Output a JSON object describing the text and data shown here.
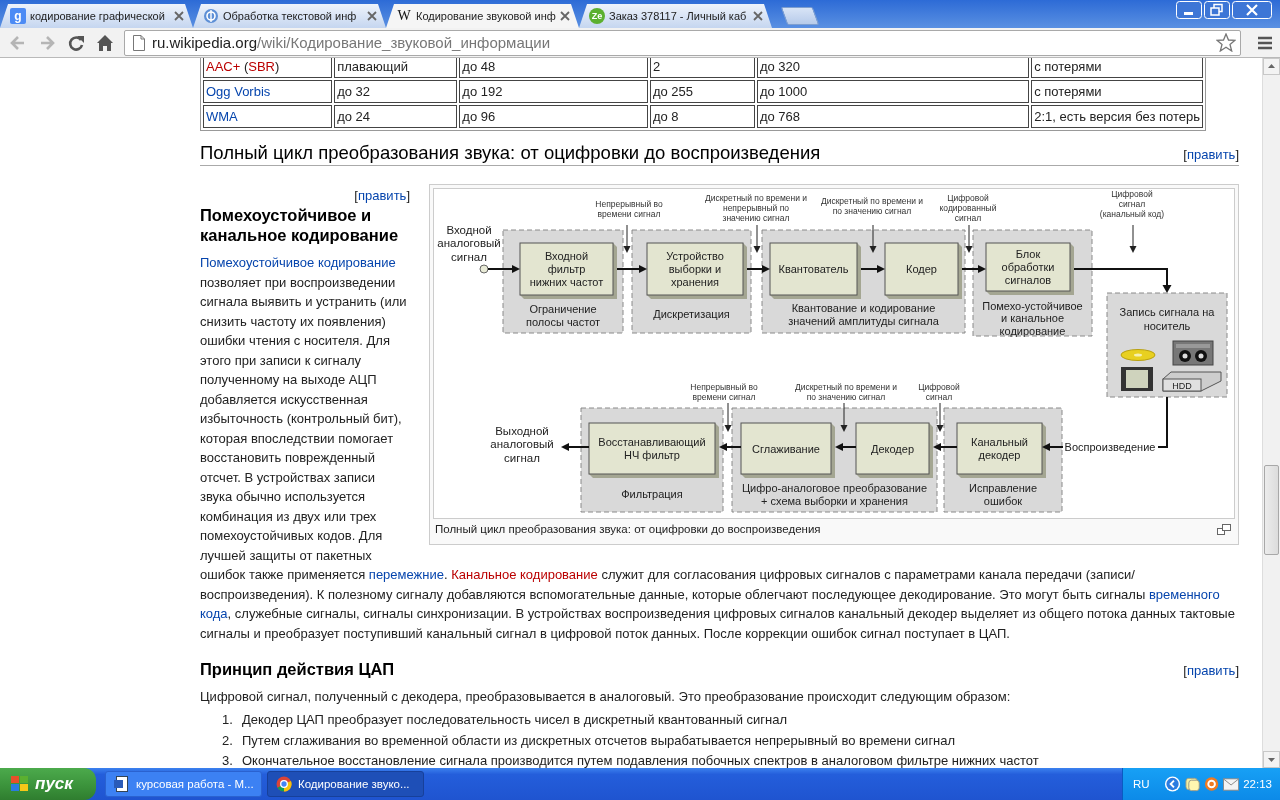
{
  "browser": {
    "tabs": [
      {
        "title": "кодирование графической",
        "selected": false,
        "kind": "square",
        "glyph": "g"
      },
      {
        "title": "Обработка текстовой инф",
        "selected": false,
        "kind": "ring"
      },
      {
        "title": "Кодирование звуковой инф",
        "selected": true,
        "kind": "letter",
        "glyph": "W"
      },
      {
        "title": "Заказ 378117 - Личный каб",
        "selected": false,
        "kind": "badge",
        "glyph": "Ze"
      }
    ],
    "url": {
      "host": "ru.wikipedia.org",
      "path": "/wiki/Кодирование_звуковой_информации"
    }
  },
  "article": {
    "table_rows": [
      {
        "cells": [
          [
            {
              "text": "AAC+",
              "kind": "missing"
            },
            {
              "text": " (",
              "kind": "plain"
            },
            {
              "text": "SBR",
              "kind": "missing"
            },
            {
              "text": ")",
              "kind": "plain"
            }
          ],
          "плавающий",
          "до 48",
          "2",
          "до 320",
          "с потерями"
        ]
      },
      {
        "cells": [
          [
            {
              "text": "Ogg Vorbis",
              "kind": "existing"
            }
          ],
          "до 32",
          "до 192",
          "до 255",
          "до 1000",
          "с потерями"
        ]
      },
      {
        "cells": [
          [
            {
              "text": "WMA",
              "kind": "existing"
            }
          ],
          "до 24",
          "до 96",
          "до 8",
          "до 768",
          "2:1, есть версия без потерь"
        ]
      }
    ],
    "section_heading": "Полный цикл преобразования звука: от оцифровки до воспроизведения",
    "section_edit": [
      {
        "text": "[",
        "kind": "plain"
      },
      {
        "text": "править",
        "kind": "existing"
      },
      {
        "text": "]",
        "kind": "plain"
      }
    ],
    "subsection_edit": [
      {
        "text": "[",
        "kind": "plain"
      },
      {
        "text": "править",
        "kind": "existing"
      },
      {
        "text": "]",
        "kind": "plain"
      }
    ],
    "subsection_heading": "Помехоустойчивое и канальное кодирование",
    "paragraph_beside_figure": [
      {
        "text": "Помехоустойчивое кодирование",
        "kind": "existing"
      },
      {
        "text": " позволяет при воспроизведении сигнала выявить и устранить (или снизить частоту их появления) ошибки чтения с носителя. Для этого при записи к сигналу полученному на выходе АЦП добавляется искусственная избыточность (контрольный бит), которая впоследствии помогает восстановить поврежденный отсчет. В устройствах записи звука обычно используется комбинация из двух или трех помехоустойчивых кодов. Для лучшей защиты от пакетных",
        "kind": "plain"
      }
    ],
    "paragraph_below_figure": [
      {
        "text": "ошибок также применяется ",
        "kind": "plain"
      },
      {
        "text": "перемежние",
        "kind": "existing"
      },
      {
        "text": ". ",
        "kind": "plain"
      },
      {
        "text": "Канальное кодирование",
        "kind": "missing"
      },
      {
        "text": " служит для согласования цифровых сигналов с параметрами канала передачи (записи/воспроизведения). К полезному сигналу добавляются вспомогательные данные, которые облегчают последующее декодирование. Это могут быть сигналы ",
        "kind": "plain"
      },
      {
        "text": "временного",
        "kind": "existing"
      },
      {
        "text": "кода",
        "kind": "existing"
      },
      {
        "text": ", служебные сигналы, сигналы синхронизации. В устройствах воспроизведения цифровых сигналов канальный декодер выделяет из общего потока данных тактовые сигналы и преобразует поступивший канальный сигнал в цифровой поток данных. После коррекции ошибок сигнал поступает в ЦАП.",
        "kind": "plain"
      }
    ],
    "figure": {
      "caption": "Полный цикл преобразования звука: от оцифровки до воспроизведения",
      "diagram": {
        "input_label": [
          "Входной",
          "аналоговый",
          "сигнал"
        ],
        "stages": [
          {
            "caption": [
              "Ограничение",
              "полосы частот"
            ],
            "blocks": [
              [
                "Входной",
                "фильтр",
                "нижних частот"
              ]
            ]
          },
          {
            "caption": [
              "Дискретизация"
            ],
            "blocks": [
              [
                "Устройство",
                "выборки и",
                "хранения"
              ]
            ]
          },
          {
            "caption": [
              "Квантование и кодирование",
              "значений амплитуды сигнала"
            ],
            "blocks": [
              [
                "Квантователь"
              ],
              [
                "Кодер"
              ]
            ]
          },
          {
            "caption": [
              "Помехо-устойчивое",
              "и канальное",
              "кодирование"
            ],
            "blocks": [
              [
                "Блок",
                "обработки",
                "сигналов"
              ]
            ]
          },
          {
            "caption": [
              "Фильтрация"
            ],
            "blocks": [
              [
                "Восстанавливающий",
                "НЧ фильтр"
              ]
            ]
          },
          {
            "caption": [
              "Цифро-аналоговое преобразование",
              "+ схема выборки и хранения"
            ],
            "blocks": [
              [
                "Сглаживание"
              ],
              [
                "Декодер"
              ]
            ]
          },
          {
            "caption": [
              "Исправление",
              "ошибок"
            ],
            "blocks": [
              [
                "Канальный",
                "декодер"
              ]
            ]
          }
        ],
        "signals": [
          {
            "lines": [
              "Непрерывный во",
              "времени сигнал"
            ]
          },
          {
            "lines": [
              "Дискретный по времени и",
              "непрерывный по",
              "значению сигнал"
            ]
          },
          {
            "lines": [
              "Дискретный по времени и",
              "по значению сигнал"
            ]
          },
          {
            "lines": [
              "Цифровой",
              "кодированный",
              "сигнал"
            ]
          },
          {
            "lines": [
              "Цифровой",
              "сигнал",
              "(канальный код)"
            ]
          },
          {
            "lines": [
              "Непрерывный во",
              "времени сигнал"
            ]
          },
          {
            "lines": [
              "Дискретный по времени и",
              "по значению сигнал"
            ]
          },
          {
            "lines": [
              "Цифровой",
              "сигнал"
            ]
          }
        ],
        "storage": {
          "title": [
            "Запись сигнала на",
            "носитель"
          ],
          "hdd_label": "HDD"
        },
        "playback_label": "Воспроизведение",
        "output_label": [
          "Выходной",
          "аналоговый",
          "сигнал"
        ]
      }
    },
    "dac_heading": "Принцип действия ЦАП",
    "dac_edit": [
      {
        "text": "[",
        "kind": "plain"
      },
      {
        "text": "править",
        "kind": "existing"
      },
      {
        "text": "]",
        "kind": "plain"
      }
    ],
    "dac_paragraph": "Цифровой сигнал, полученный с декодера, преобразовывается в аналоговый. Это преобразование происходит следующим образом:",
    "dac_steps": [
      {
        "number": "1.",
        "text": "Декодер ЦАП преобразует последовательность чисел в дискретный квантованный сигнал"
      },
      {
        "number": "2.",
        "text": "Путем сглаживания во временной области из дискретных отсчетов вырабатывается непрерывный во времени сигнал"
      },
      {
        "number": "3.",
        "text": "Окончательное восстановление сигнала производится путем подавления побочных спектров в аналоговом фильтре нижних частот"
      }
    ]
  },
  "taskbar": {
    "start": "пуск",
    "tasks": [
      {
        "title": "курсовая работа - М...",
        "selected": false,
        "kind": "document"
      },
      {
        "title": "Кодирование звуко...",
        "selected": true,
        "kind": "browser"
      }
    ],
    "language": "RU",
    "time": "22:13"
  }
}
